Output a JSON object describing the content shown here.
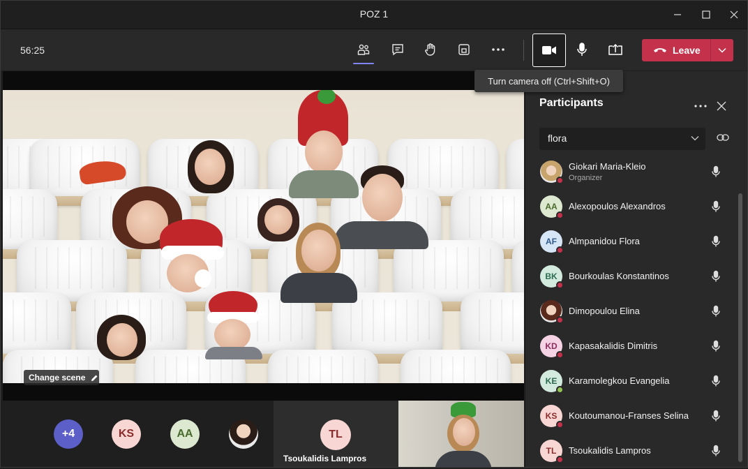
{
  "window": {
    "title": "POZ 1"
  },
  "toolbar": {
    "timer": "56:25",
    "tooltip": "Turn camera off (Ctrl+Shift+O)",
    "leave_label": "Leave"
  },
  "stage": {
    "change_scene_label": "Change scene"
  },
  "gallery": {
    "overflow_count": "+4",
    "avatars": [
      "KS",
      "AA"
    ],
    "active_tile": {
      "initials": "TL",
      "name": "Tsoukalidis Lampros"
    }
  },
  "participants": {
    "title": "Participants",
    "search_value": "flora",
    "items": [
      {
        "initials": "",
        "name": "Giokari Maria-Kleio",
        "role": "Organizer",
        "photo": true
      },
      {
        "initials": "AA",
        "name": "Alexopoulos Alexandros"
      },
      {
        "initials": "AF",
        "name": "Almpanidou Flora"
      },
      {
        "initials": "BK",
        "name": "Bourkoulas Konstantinos"
      },
      {
        "initials": "",
        "name": "Dimopoulou Elina",
        "photo": true
      },
      {
        "initials": "KD",
        "name": "Kapasakalidis Dimitris"
      },
      {
        "initials": "KE",
        "name": "Karamolegkou Evangelia",
        "status": "available"
      },
      {
        "initials": "KS",
        "name": "Koutoumanou-Franses Selina"
      },
      {
        "initials": "TL",
        "name": "Tsoukalidis Lampros"
      }
    ]
  },
  "colors": {
    "accent": "#7f85f5",
    "leave": "#c4314b",
    "panel_bg": "#292929",
    "toolbar_bg": "#292929"
  }
}
